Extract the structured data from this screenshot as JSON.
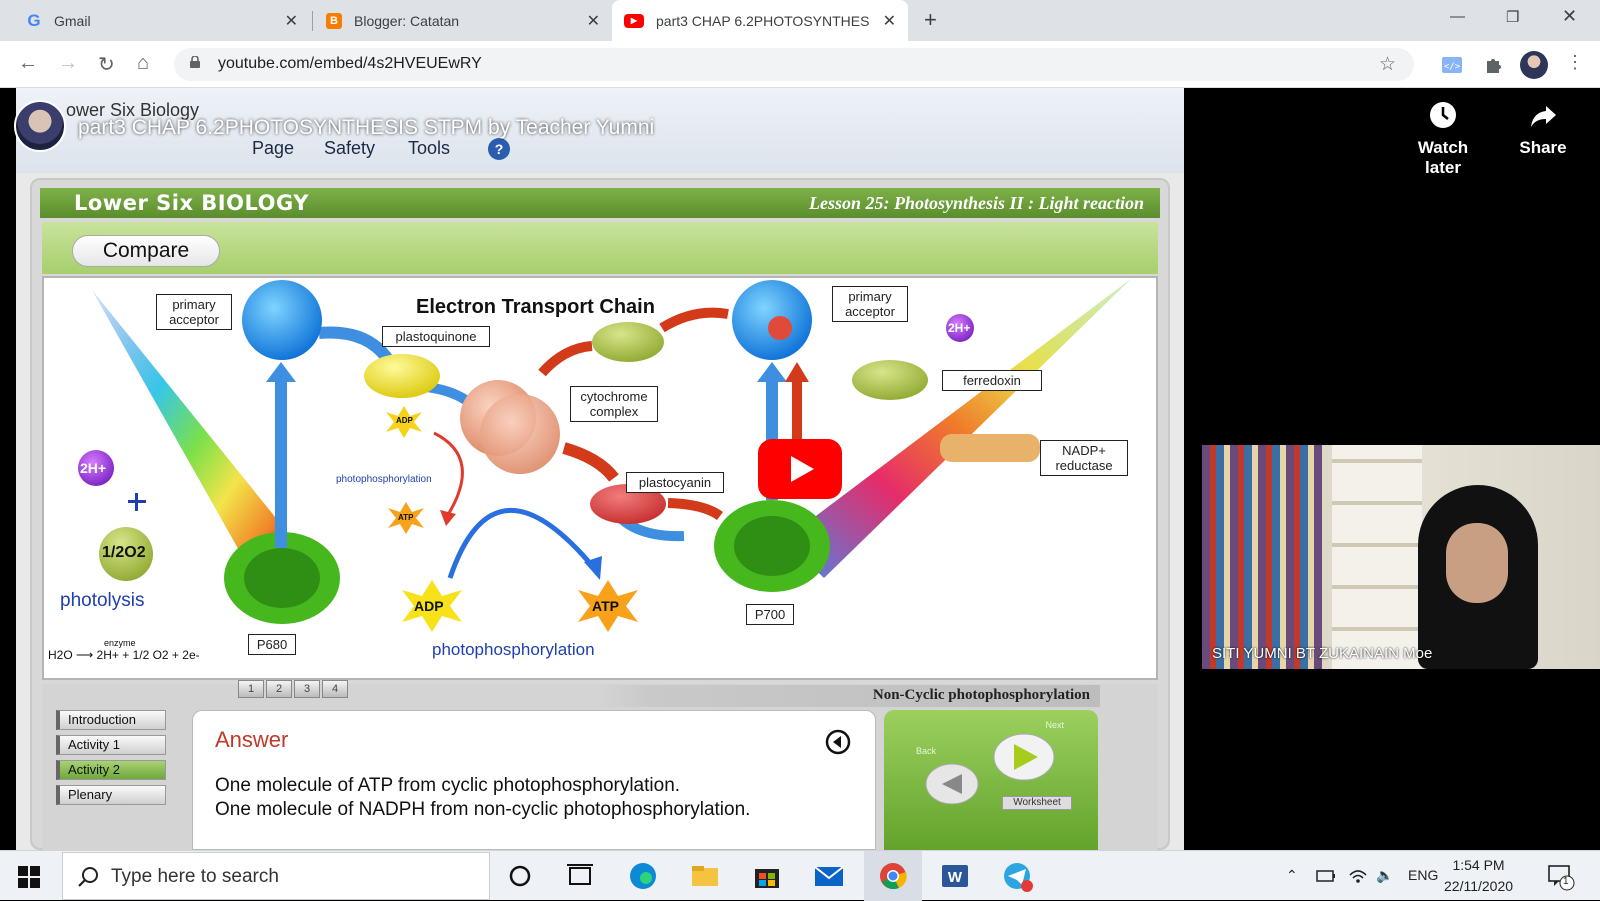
{
  "browser": {
    "tabs": [
      {
        "title": "Gmail",
        "icon": "google-icon"
      },
      {
        "title": "Blogger: Catatan",
        "icon": "blogger-icon"
      },
      {
        "title": "part3 CHAP 6.2PHOTOSYNTHESI",
        "icon": "youtube-icon",
        "active": true
      }
    ],
    "url": "youtube.com/embed/4s2HVEUEwRY"
  },
  "video": {
    "title": "part3 CHAP 6.2PHOTOSYNTHESIS STPM by Teacher Yumni",
    "background_tab": "ower Six Biology",
    "watch_later": "Watch later",
    "share": "Share",
    "ie_menu": [
      "Page",
      "Safety",
      "Tools"
    ]
  },
  "slide": {
    "header_left": "Lower Six BIOLOGY",
    "header_right": "Lesson 25: Photosynthesis II : Light reaction",
    "compare_button": "Compare",
    "diagram": {
      "title": "Electron Transport Chain",
      "primary_acceptor_1": "primary acceptor",
      "primary_acceptor_2": "primary acceptor",
      "plastoquinone": "plastoquinone",
      "cytochrome": "cytochrome complex",
      "plastocyanin": "plastocyanin",
      "ferredoxin": "ferredoxin",
      "nadp_reductase": "NADP+ reductase",
      "p680": "P680",
      "p700": "P700",
      "two_h_left": "2H+",
      "two_h_right": "2H+",
      "half_o2": "1/2O2",
      "photolysis": "photolysis",
      "equation": "H2O ⟶ 2H+ + 1/2 O2 + 2e-",
      "enzyme": "enzyme",
      "photophos_small": "photophosphorylation",
      "photophos_big": "photophosphorylation",
      "adp_small": "ADP",
      "atp_small": "ATP",
      "adp_big": "ADP",
      "atp_big": "ATP"
    },
    "page_tabs": [
      "1",
      "2",
      "3",
      "4"
    ],
    "noncyclic_label": "Non-Cyclic photophosphorylation",
    "side_menu": [
      {
        "label": "Introduction",
        "active": false
      },
      {
        "label": "Activity 1",
        "active": false
      },
      {
        "label": "Activity 2",
        "active": true
      },
      {
        "label": "Plenary",
        "active": false
      }
    ],
    "answer": {
      "title": "Answer",
      "line1": "One molecule of ATP from cyclic photophosphorylation.",
      "line2": "One molecule of NADPH from non-cyclic photophosphorylation."
    },
    "nav": {
      "back": "Back",
      "next": "Next",
      "worksheet": "Worksheet"
    }
  },
  "webcam": {
    "name": "SITI YUMNI BT ZUKAINAIN Moe"
  },
  "taskbar": {
    "search_placeholder": "Type here to search",
    "language": "ENG",
    "time": "1:54 PM",
    "date": "22/11/2020",
    "notification_count": "1"
  },
  "colors": {
    "youtube_red": "#ff0000",
    "slide_green": "#6ea83b",
    "answer_red": "#c0392b"
  }
}
